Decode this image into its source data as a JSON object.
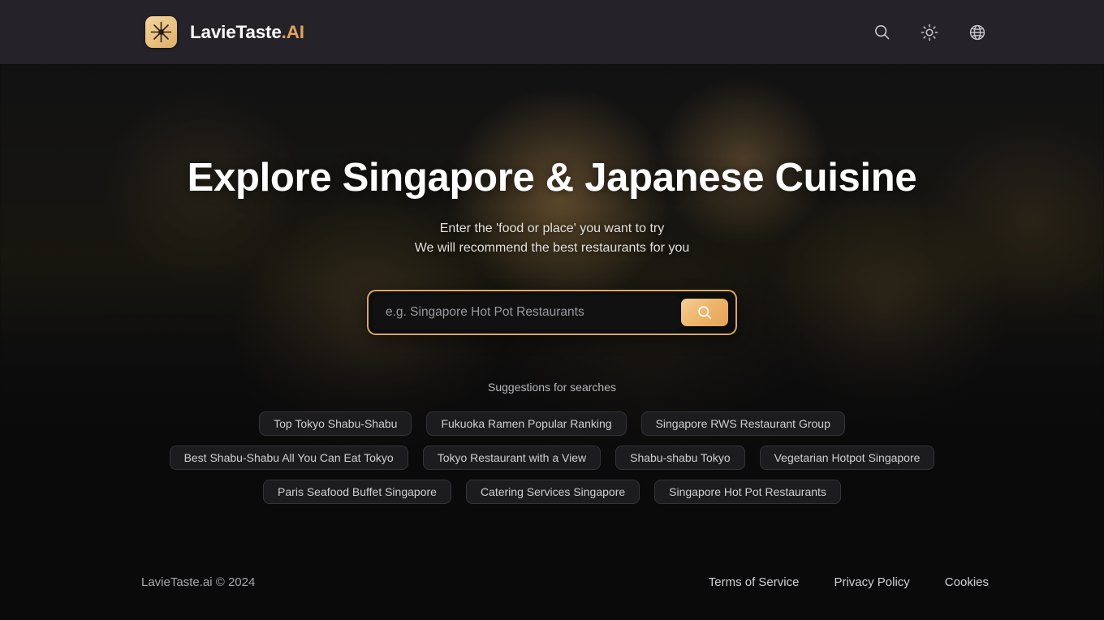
{
  "header": {
    "logo_icon": "starburst-logo-icon",
    "brand_primary": "LavieTaste",
    "brand_suffix": ".AI",
    "brand_accent_color": "#e0a35c",
    "actions": [
      {
        "name": "search-icon",
        "label": "Search"
      },
      {
        "name": "sun-icon",
        "label": "Light mode"
      },
      {
        "name": "globe-icon",
        "label": "Language"
      }
    ],
    "background_color": "#252229"
  },
  "hero": {
    "title": "Explore Singapore & Japanese Cuisine",
    "subtitle_line1": "Enter the 'food or place' you want to try",
    "subtitle_line2": "We will recommend the best restaurants for you"
  },
  "search": {
    "placeholder": "e.g. Singapore Hot Pot Restaurants",
    "value": "",
    "button_icon": "search-icon",
    "border_color": "#d9a95f",
    "button_color": "#eeb66d"
  },
  "suggestions": {
    "label": "Suggestions for searches",
    "rows": [
      [
        "Top Tokyo Shabu-Shabu",
        "Fukuoka Ramen Popular Ranking",
        "Singapore RWS Restaurant Group"
      ],
      [
        "Best Shabu-Shabu All You Can Eat Tokyo",
        "Tokyo Restaurant with a View",
        "Shabu-shabu Tokyo",
        "Vegetarian Hotpot Singapore"
      ],
      [
        "Paris Seafood Buffet Singapore",
        "Catering Services Singapore",
        "Singapore Hot Pot Restaurants"
      ]
    ]
  },
  "footer": {
    "copyright": "LavieTaste.ai © 2024",
    "links": [
      "Terms of Service",
      "Privacy Policy",
      "Cookies"
    ]
  }
}
